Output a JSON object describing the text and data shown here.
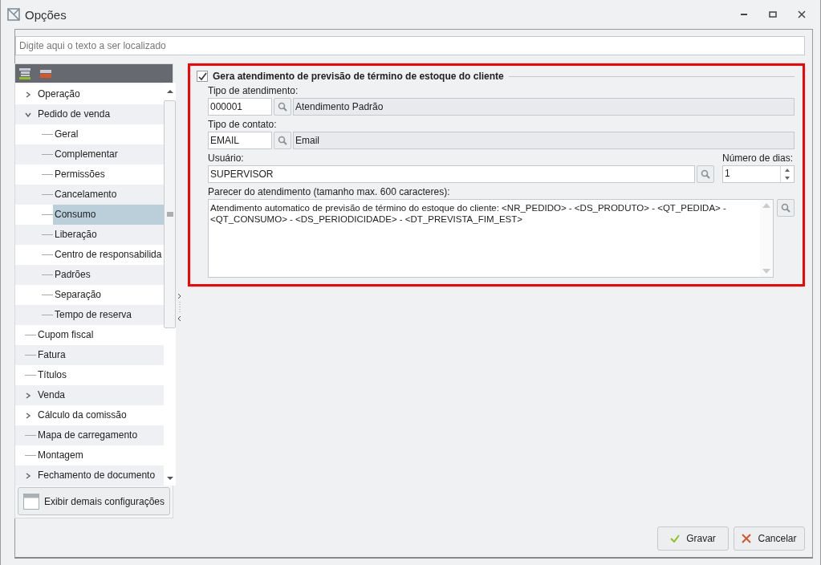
{
  "window": {
    "title": "Opções"
  },
  "search": {
    "placeholder": "Digite aqui o texto a ser localizado"
  },
  "tree": [
    {
      "label": "Operação",
      "expanded": false,
      "selected": false
    },
    {
      "label": "Pedido de venda",
      "expanded": true,
      "selected": false,
      "children": [
        {
          "label": "Geral",
          "selected": false
        },
        {
          "label": "Complementar",
          "selected": false
        },
        {
          "label": "Permissões",
          "selected": false
        },
        {
          "label": "Cancelamento",
          "selected": false
        },
        {
          "label": "Consumo",
          "selected": true
        },
        {
          "label": "Liberação",
          "selected": false
        },
        {
          "label": "Centro de responsabilida",
          "selected": false
        },
        {
          "label": "Padrões",
          "selected": false
        },
        {
          "label": "Separação",
          "selected": false
        },
        {
          "label": "Tempo de reserva",
          "selected": false
        }
      ]
    },
    {
      "label": "Cupom fiscal",
      "selected": false
    },
    {
      "label": "Fatura",
      "selected": false
    },
    {
      "label": "Títulos",
      "selected": false
    },
    {
      "label": "Venda",
      "expanded": false,
      "selected": false
    },
    {
      "label": "Cálculo da comissão",
      "expanded": false,
      "selected": false
    },
    {
      "label": "Mapa de carregamento",
      "selected": false
    },
    {
      "label": "Montagem",
      "selected": false
    },
    {
      "label": "Fechamento de documento",
      "expanded": false,
      "selected": false
    }
  ],
  "more_button": "Exibir demais configurações",
  "section": {
    "title": "Gera atendimento de previsão de término de estoque do cliente",
    "checked": true
  },
  "tipo_atendimento": {
    "label": "Tipo de atendimento:",
    "code": "000001",
    "description": "Atendimento Padrão"
  },
  "tipo_contato": {
    "label": "Tipo de contato:",
    "code": "EMAIL",
    "description": "Email"
  },
  "usuario": {
    "label": "Usuário:",
    "value": "SUPERVISOR"
  },
  "numero_dias": {
    "label": "Número de dias:",
    "value": "1"
  },
  "parecer": {
    "label": "Parecer do atendimento (tamanho max. 600 caracteres):",
    "value": "Atendimento automatico de previsão de término do estoque do cliente: <NR_PEDIDO> - <DS_PRODUTO> - <QT_PEDIDA> - <QT_CONSUMO> - <DS_PERIODICIDADE> - <DT_PREVISTA_FIM_EST>"
  },
  "buttons": [
    {
      "label": "Gravar",
      "kind": "save"
    },
    {
      "label": "Cancelar",
      "kind": "cancel"
    }
  ]
}
